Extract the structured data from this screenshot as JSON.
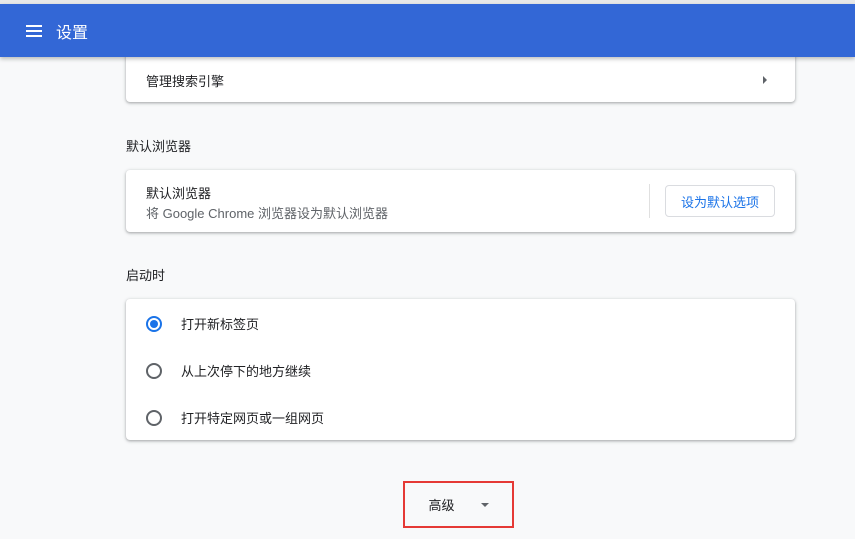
{
  "header": {
    "title": "设置"
  },
  "search_engine": {
    "manage_label": "管理搜索引擎"
  },
  "default_browser": {
    "section_title": "默认浏览器",
    "card_title": "默认浏览器",
    "description": "将 Google Chrome 浏览器设为默认浏览器",
    "button_label": "设为默认选项"
  },
  "on_startup": {
    "section_title": "启动时",
    "options": [
      {
        "label": "打开新标签页",
        "selected": true
      },
      {
        "label": "从上次停下的地方继续",
        "selected": false
      },
      {
        "label": "打开特定网页或一组网页",
        "selected": false
      }
    ]
  },
  "advanced": {
    "label": "高级"
  }
}
